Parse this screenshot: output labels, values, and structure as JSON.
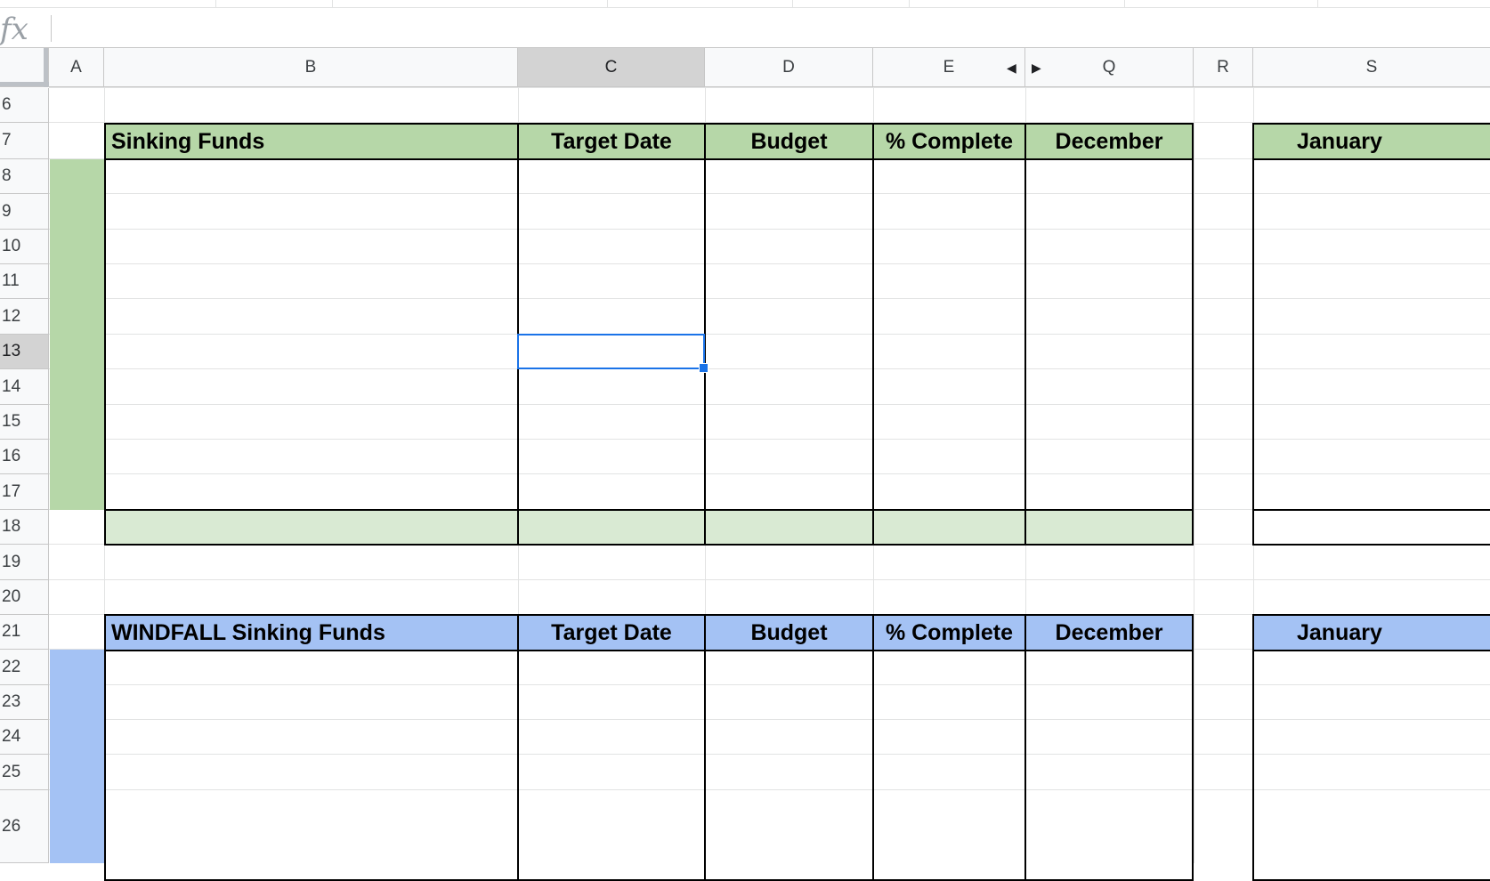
{
  "formula_bar": {
    "icon": "fx",
    "value": ""
  },
  "columns": [
    "A",
    "B",
    "C",
    "D",
    "E",
    "Q",
    "R",
    "S"
  ],
  "selected_column": "C",
  "rows": [
    "6",
    "7",
    "8",
    "9",
    "10",
    "11",
    "12",
    "13",
    "14",
    "15",
    "16",
    "17",
    "18",
    "19",
    "20",
    "21",
    "22",
    "23",
    "24",
    "25",
    "26"
  ],
  "selected_row": "13",
  "selected_cell": "C13",
  "colors": {
    "sinking_header": "#b6d7a8",
    "sinking_side": "#b6d7a8",
    "sinking_total": "#d9ead3",
    "windfall_header": "#a4c2f4",
    "windfall_side": "#a4c2f4",
    "selection": "#1a73e8"
  },
  "sinking_funds": {
    "title": "Sinking Funds",
    "target_date": "Target Date",
    "budget": "Budget",
    "percent_complete": "% Complete",
    "december": "December",
    "january": "January"
  },
  "windfall_funds": {
    "title": "WINDFALL Sinking Funds",
    "target_date": "Target Date",
    "budget": "Budget",
    "percent_complete": "% Complete",
    "december": "December",
    "january": "January"
  }
}
